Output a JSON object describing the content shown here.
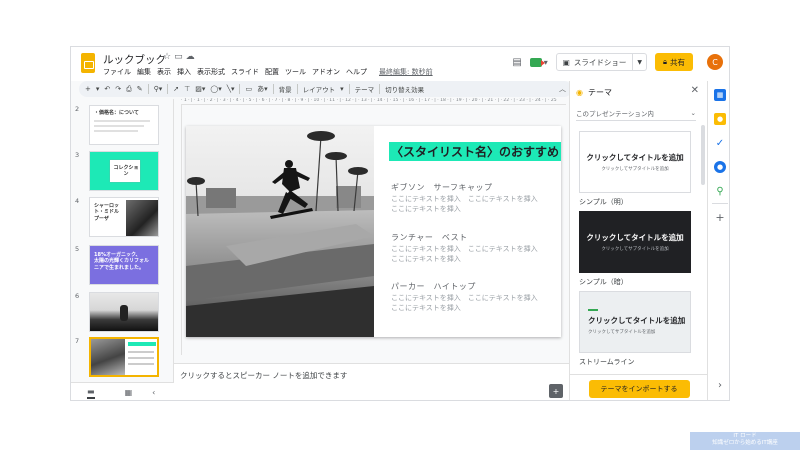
{
  "header": {
    "doc_title": "ルックブック",
    "menu": [
      "ファイル",
      "編集",
      "表示",
      "挿入",
      "表示形式",
      "スライド",
      "配置",
      "ツール",
      "アドオン",
      "ヘルプ"
    ],
    "last_edit": "最終編集: 数秒前",
    "slideshow_label": "スライドショー",
    "share_label": "共有",
    "avatar_initial": "C"
  },
  "toolbar": {
    "background_label": "背景",
    "layout_label": "レイアウト",
    "theme_label": "テーマ",
    "transition_label": "切り替え効果",
    "ruler_marks": "· 1 · | · 1 · | · 2 · | · 3 · | · 4 · | · 5 · | · 6 · | · 7 · | · 8 · | · 9 · | · 10 · | · 11 · | · 12 · | · 13 · | · 14 · | · 15 · | · 16 · | · 17 · | · 18 · | · 19 · | · 20 · | · 21 · | · 22 · | · 23 · | · 24 · | · 25"
  },
  "filmstrip": {
    "slides": [
      {
        "num": "2",
        "text": "・価格名：について"
      },
      {
        "num": "3",
        "text": "コレクション"
      },
      {
        "num": "4",
        "text": "シャーロット・ミドル\nプーザ"
      },
      {
        "num": "5",
        "text": "18%オーガニック、\n太陽の光輝くカリフォル\nニアで生まれました。"
      },
      {
        "num": "6",
        "text": ""
      },
      {
        "num": "7",
        "text": ""
      }
    ]
  },
  "slide": {
    "heading": "〈スタイリスト名〉のおすすめ",
    "products": [
      {
        "name": "ギブソン　サーフキャップ",
        "desc": "ここにテキストを挿入　ここにテキストを挿入\nここにテキストを挿入"
      },
      {
        "name": "ランチャー　ベスト",
        "desc": "ここにテキストを挿入　ここにテキストを挿入\nここにテキストを挿入"
      },
      {
        "name": "パーカー　ハイトップ",
        "desc": "ここにテキストを挿入　ここにテキストを挿入\nここにテキストを挿入"
      }
    ]
  },
  "notes": {
    "placeholder": "クリックするとスピーカー ノートを追加できます"
  },
  "themes_panel": {
    "title": "テーマ",
    "source_select": "このプレゼンテーション内",
    "themes": [
      {
        "card_title": "クリックしてタイトルを追加",
        "card_sub": "クリックしてサブタイトルを追加",
        "label": "シンプル（明）"
      },
      {
        "card_title": "クリックしてタイトルを追加",
        "card_sub": "クリックしてサブタイトルを追加",
        "label": "シンプル（暗）"
      },
      {
        "card_title": "クリックしてタイトルを追加",
        "card_sub": "クリックしてサブタイトルを追加",
        "label": "ストリームライン"
      }
    ],
    "import_label": "テーマをインポートする"
  },
  "watermark": {
    "line1": "IT ロード",
    "line2": "知識ゼロから始めるIT講座"
  },
  "colors": {
    "accent_yellow": "#fbbc04",
    "heading_highlight": "#1de9b6",
    "slide3_bg": "#1de9b6",
    "slide5_bg": "#7b6fe0",
    "dark_theme": "#202124"
  }
}
